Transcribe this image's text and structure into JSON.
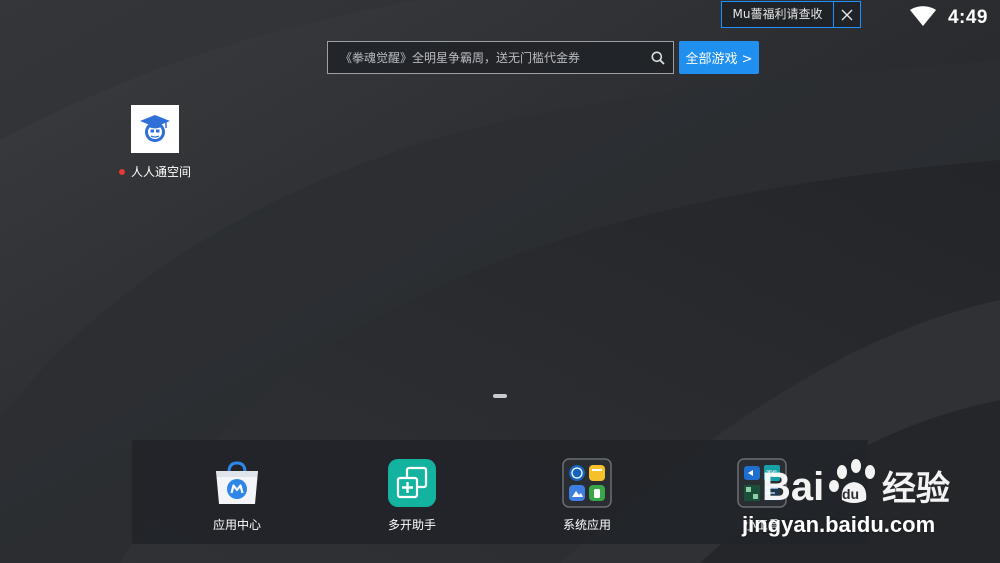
{
  "notification": {
    "text": "Mu薔福利请查收",
    "close_icon": "close-icon"
  },
  "status_bar": {
    "time": "4:49",
    "wifi_icon": "wifi-icon"
  },
  "search": {
    "placeholder": "《拳魂觉醒》全明星争霸周，送无门槛代金券",
    "icon": "search-icon"
  },
  "all_games_button": "全部游戏 >",
  "desktop_icons": [
    {
      "label": "人人通空间",
      "icon": "graduation-cap-avatar-icon",
      "has_badge": true
    }
  ],
  "dock": [
    {
      "label": "应用中心",
      "icon": "app-center-bag-icon"
    },
    {
      "label": "多开助手",
      "icon": "multi-open-icon"
    },
    {
      "label": "系统应用",
      "icon": "system-apps-folder-icon"
    },
    {
      "label": "小工具",
      "icon": "tools-folder-icon"
    }
  ],
  "watermark": {
    "logo": "Baidu经验",
    "url": "jingyan.baidu.com"
  },
  "colors": {
    "accent": "#1f8ff0",
    "badge": "#e53935",
    "background": "#26282c"
  }
}
